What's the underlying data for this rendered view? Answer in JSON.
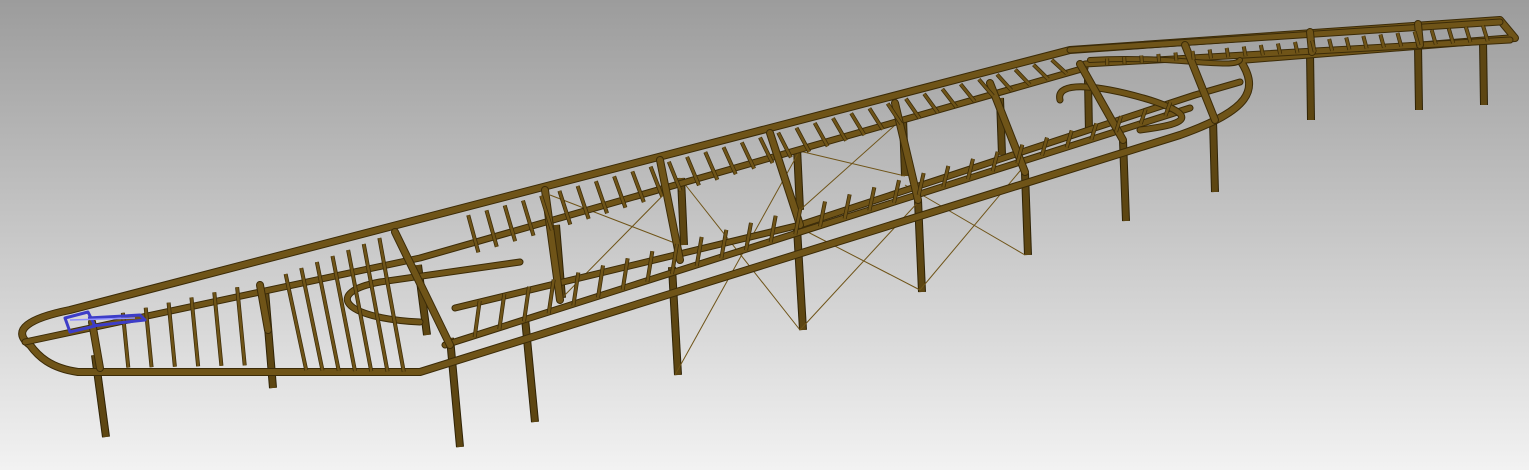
{
  "viewport": {
    "background_top": "#9c9c9c",
    "background_bottom": "#f2f2f2"
  },
  "model": {
    "beam_color": "#6f5418",
    "beam_edge": "#3b2b08",
    "deck_edge_color": "#8d8d80",
    "column_color": "#5d4612",
    "brace_color": "#6f5418",
    "selection_color": "#3d3dc8"
  }
}
